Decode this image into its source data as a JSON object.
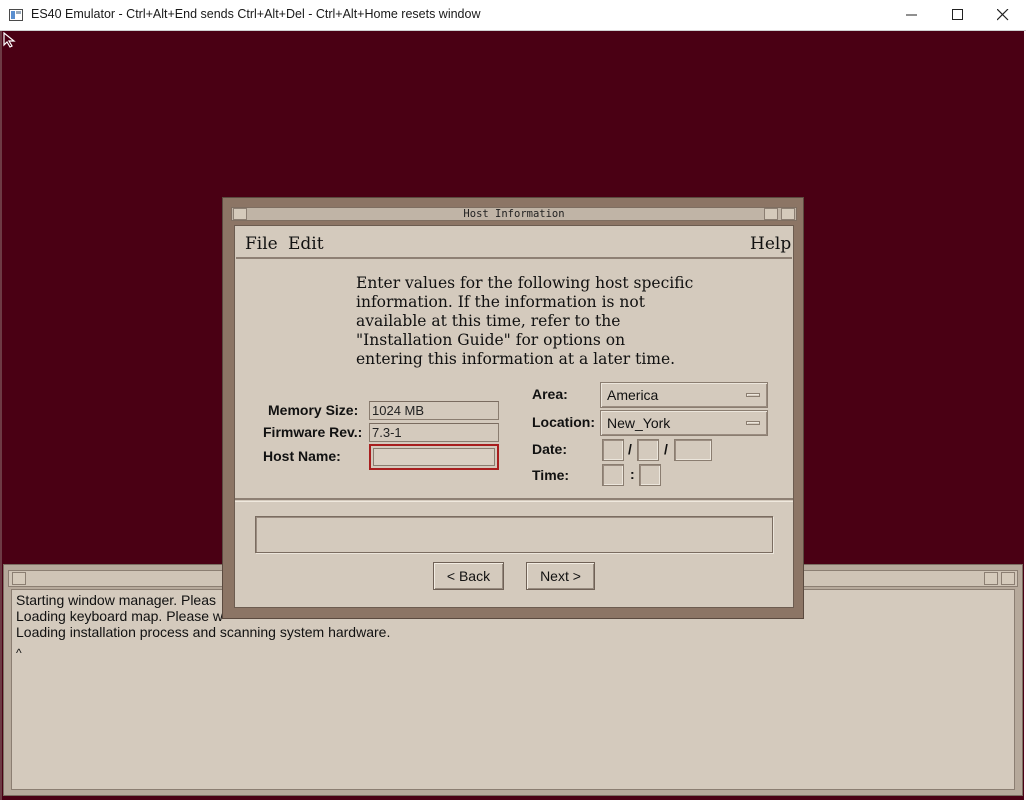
{
  "window": {
    "title": "ES40 Emulator - Ctrl+Alt+End sends Ctrl+Alt+Del - Ctrl+Alt+Home resets window",
    "controls": [
      "minimize-icon",
      "maximize-icon",
      "close-icon"
    ]
  },
  "colors": {
    "desktop": "#4a0014",
    "motif_face": "#d4cabd",
    "dialog_frame": "#8c7565",
    "focus_border": "#a81e1e"
  },
  "console": {
    "lines": [
      "Starting window manager.  Pleas",
      "Loading keyboard map.  Please w",
      "Loading installation process and scanning system hardware.",
      "^"
    ]
  },
  "dialog": {
    "title": "Host Information",
    "menu": {
      "file": "File",
      "edit": "Edit",
      "help": "Help"
    },
    "intro": [
      "Enter values for the following host specific",
      "information.  If the information is not",
      "available at this time, refer to the",
      "\"Installation Guide\" for options on",
      "entering this information at a later time."
    ],
    "memory_size": {
      "label": "Memory Size:",
      "value": "1024 MB"
    },
    "firmware_rev": {
      "label": "Firmware Rev.:",
      "value": "7.3-1"
    },
    "host_name": {
      "label": "Host Name:",
      "value": ""
    },
    "area": {
      "label": "Area:",
      "value": "America"
    },
    "location": {
      "label": "Location:",
      "value": "New_York"
    },
    "date": {
      "label": "Date:",
      "separator": "/"
    },
    "time": {
      "label": "Time:",
      "separator": ":"
    },
    "buttons": {
      "back": "< Back",
      "next": "Next >"
    }
  }
}
